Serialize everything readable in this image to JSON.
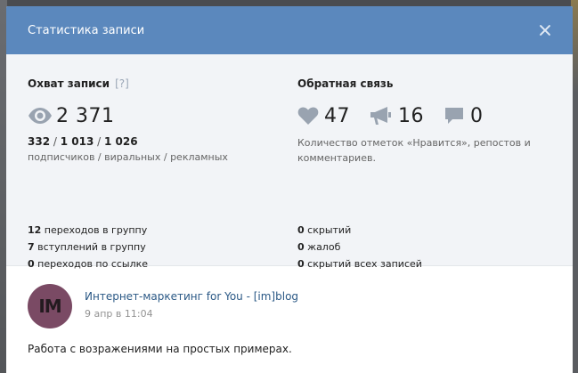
{
  "modal": {
    "title": "Статистика записи"
  },
  "reach": {
    "title": "Охват записи",
    "help": "[?]",
    "total": "2 371",
    "subscribers": "332",
    "viral": "1 013",
    "ads": "1 026",
    "breakdown_sep": " / ",
    "breakdown_label": "подписчиков / виральных / рекламных"
  },
  "feedback": {
    "title": "Обратная связь",
    "likes": "47",
    "reposts": "16",
    "comments": "0",
    "description": "Количество отметок «Нравится», репостов и комментариев."
  },
  "actions": {
    "group_visits_count": "12",
    "group_visits_label": " переходов в группу",
    "joins_count": "7",
    "joins_label": " вступлений в группу",
    "link_clicks_count": "0",
    "link_clicks_label": " переходов по ссылке"
  },
  "negative": {
    "hidden_count": "0",
    "hidden_label": " скрытий",
    "complaints_count": "0",
    "complaints_label": " жалоб",
    "hidden_all_count": "0",
    "hidden_all_label": " скрытий всех записей"
  },
  "post": {
    "avatar_text": "IM",
    "author": "Интернет-маркетинг for You - [im]blog",
    "date": "9 апр в 11:04",
    "text": "Работа с возражениями на простых примерах."
  },
  "colors": {
    "header": "#5b88bd",
    "stats_bg": "#f2f4f7",
    "link": "#2a5885",
    "icon": "#99a3b0"
  },
  "icons": [
    "eye-icon",
    "heart-icon",
    "megaphone-icon",
    "comment-icon",
    "close-icon"
  ]
}
